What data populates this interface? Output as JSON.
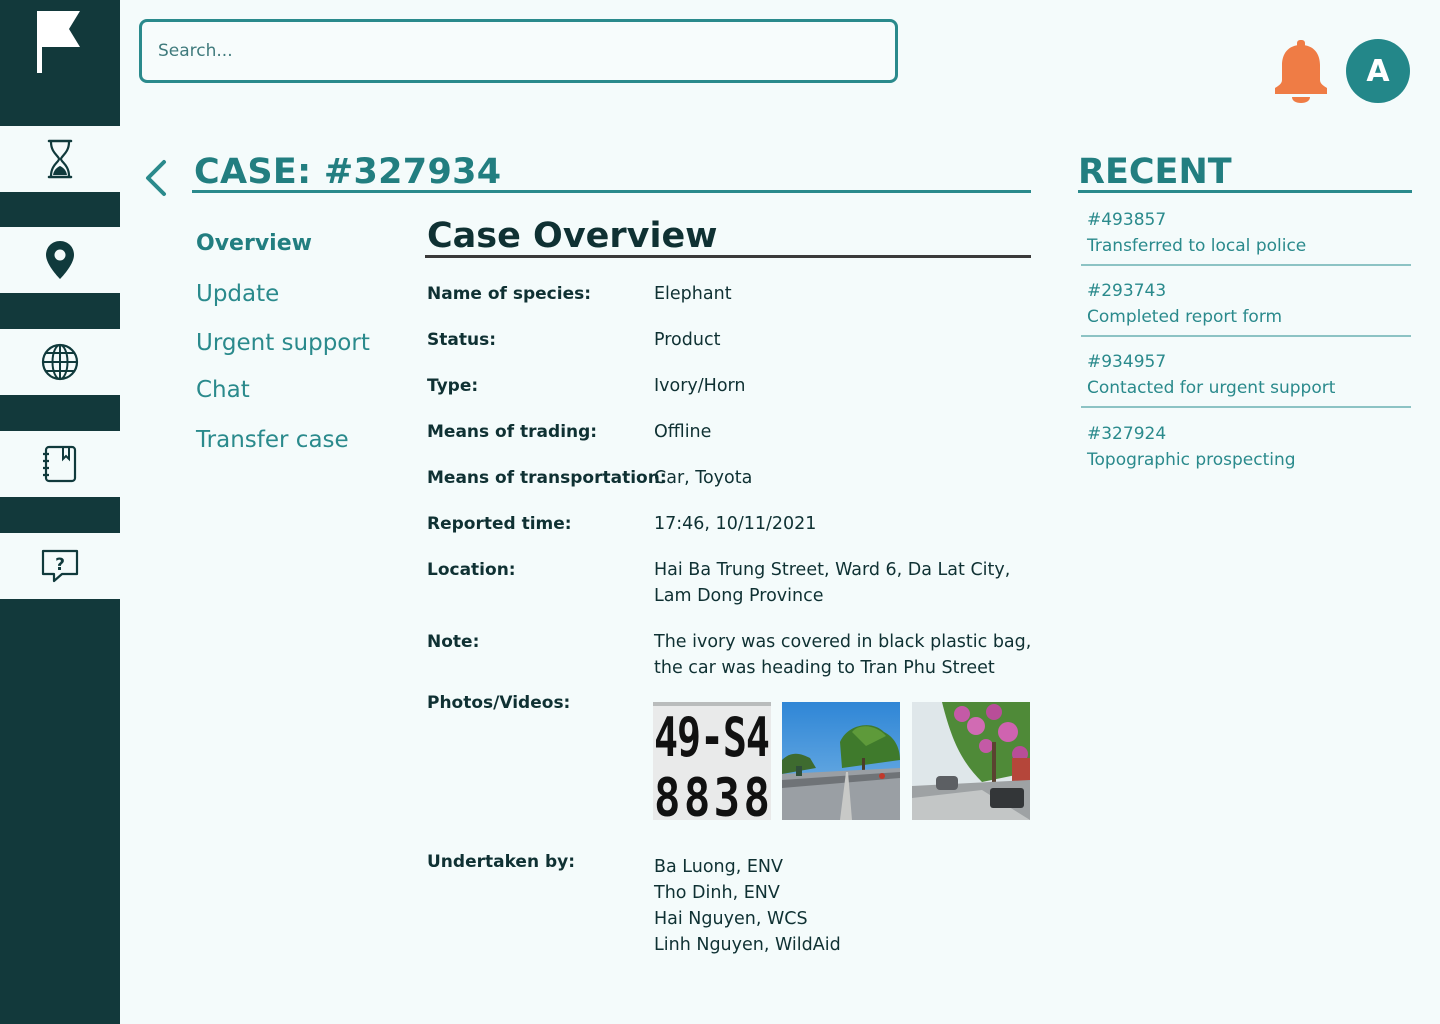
{
  "search": {
    "placeholder": "Search..."
  },
  "header": {
    "avatar_letter": "A"
  },
  "case": {
    "title": "CASE: #327934"
  },
  "subnav": [
    "Overview",
    "Update",
    "Urgent support",
    "Chat",
    "Transfer case"
  ],
  "overview": {
    "title": "Case Overview",
    "fields": [
      {
        "label": "Name of species:",
        "value": "Elephant"
      },
      {
        "label": "Status:",
        "value": "Product"
      },
      {
        "label": "Type:",
        "value": "Ivory/Horn"
      },
      {
        "label": "Means of trading:",
        "value": "Offline"
      },
      {
        "label": "Means of transportation:",
        "value": "Car, Toyota"
      },
      {
        "label": "Reported time:",
        "value": "17:46, 10/11/2021"
      },
      {
        "label": "Location:",
        "value": [
          "Hai Ba Trung Street, Ward 6, Da Lat City,",
          "Lam Dong Province"
        ]
      },
      {
        "label": "Note:",
        "value": [
          "The ivory was covered in black plastic bag,",
          "the car was heading to Tran Phu Street"
        ]
      },
      {
        "label": "Photos/Videos:"
      },
      {
        "label": "Undertaken by:",
        "value": [
          "Ba Luong, ENV",
          "Tho Dinh, ENV",
          "Hai Nguyen, WCS",
          "Linh Nguyen, WildAid"
        ]
      }
    ],
    "license_plate": {
      "line1": "49-S4",
      "line2": "8838"
    }
  },
  "recent": {
    "title": "RECENT",
    "items": [
      {
        "id": "#493857",
        "desc": "Transferred to local police"
      },
      {
        "id": "#293743",
        "desc": "Completed report form"
      },
      {
        "id": "#934957",
        "desc": "Contacted for urgent support"
      },
      {
        "id": "#327924",
        "desc": "Topographic prospecting"
      }
    ]
  },
  "colors": {
    "sidebar": "#12393b",
    "accent": "#2a8a8c",
    "bell": "#ef7c45",
    "avatar": "#238789"
  }
}
